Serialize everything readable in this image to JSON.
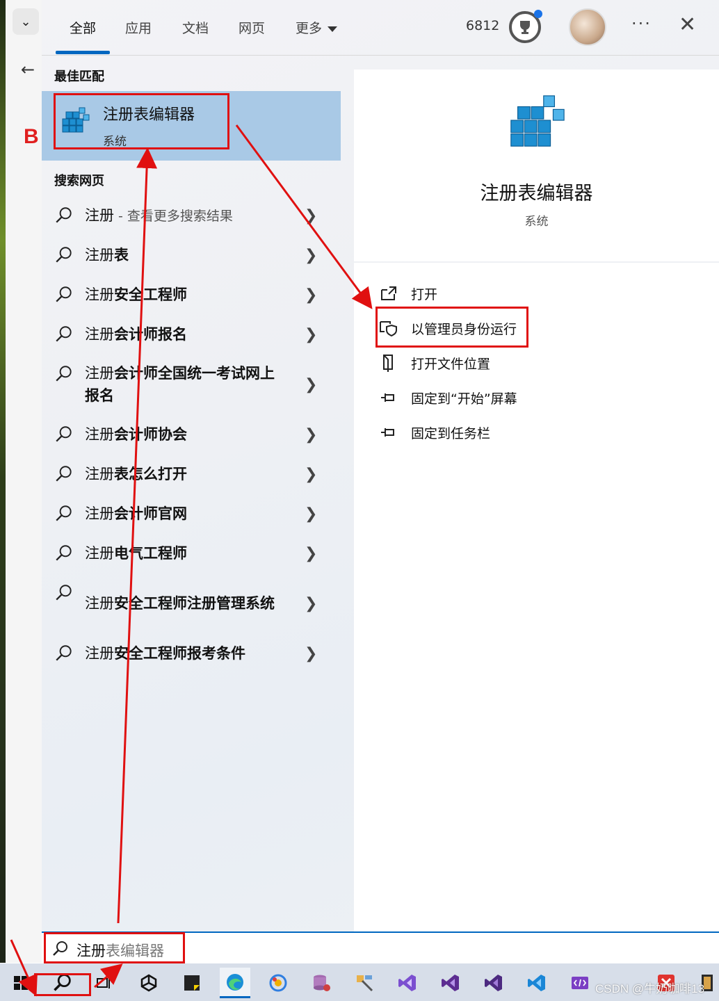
{
  "tabs": [
    {
      "label": "全部",
      "active": true
    },
    {
      "label": "应用"
    },
    {
      "label": "文档"
    },
    {
      "label": "网页"
    },
    {
      "label": "更多"
    }
  ],
  "header": {
    "points": "6812",
    "more_icon": "ellipsis-icon",
    "close_icon": "close-icon"
  },
  "left_app": {
    "letter": "B"
  },
  "best_match": {
    "section": "最佳匹配",
    "title": "注册表编辑器",
    "subtitle": "系统"
  },
  "web": {
    "section": "搜索网页",
    "items": [
      {
        "prefix": "注册",
        "bold": "",
        "hint": " - 查看更多搜索结果"
      },
      {
        "prefix": "注册",
        "bold": "表",
        "hint": ""
      },
      {
        "prefix": "注册",
        "bold": "安全工程师",
        "hint": ""
      },
      {
        "prefix": "注册",
        "bold": "会计师报名",
        "hint": ""
      },
      {
        "prefix": "注册",
        "bold": "会计师全国统一考试网上报名",
        "hint": ""
      },
      {
        "prefix": "注册",
        "bold": "会计师协会",
        "hint": ""
      },
      {
        "prefix": "注册",
        "bold": "表怎么打开",
        "hint": ""
      },
      {
        "prefix": "注册",
        "bold": "会计师官网",
        "hint": ""
      },
      {
        "prefix": "注册",
        "bold": "电气工程师",
        "hint": ""
      },
      {
        "prefix": "注册",
        "bold": "安全工程师注册管理系统",
        "hint": ""
      },
      {
        "prefix": "注册",
        "bold": "安全工程师报考条件",
        "hint": ""
      }
    ]
  },
  "detail": {
    "title": "注册表编辑器",
    "subtitle": "系统",
    "actions": [
      {
        "label": "打开",
        "icon": "open-external-icon"
      },
      {
        "label": "以管理员身份运行",
        "icon": "admin-shield-icon"
      },
      {
        "label": "打开文件位置",
        "icon": "file-location-icon"
      },
      {
        "label": "固定到“开始”屏幕",
        "icon": "pin-icon"
      },
      {
        "label": "固定到任务栏",
        "icon": "pin-icon"
      }
    ]
  },
  "search": {
    "typed": "注册",
    "ghost": "表编辑器"
  },
  "taskbar": {
    "apps": [
      "start-icon",
      "search-icon",
      "task-view-icon",
      "unity-icon",
      "sticky-notes-icon",
      "edge-icon",
      "chrome-like-icon",
      "database-icon",
      "tools-icon",
      "vs-blue-icon",
      "visual-studio-icon",
      "visual-studio-preview-icon",
      "vscode-icon",
      "dev-tool-icon",
      "xmind-icon",
      "book-icon"
    ]
  },
  "watermark": "CSDN @牛奶咖啡13",
  "colors": {
    "accent": "#0067c0",
    "selected": "#a9c9e6",
    "annotation": "#e01010"
  }
}
